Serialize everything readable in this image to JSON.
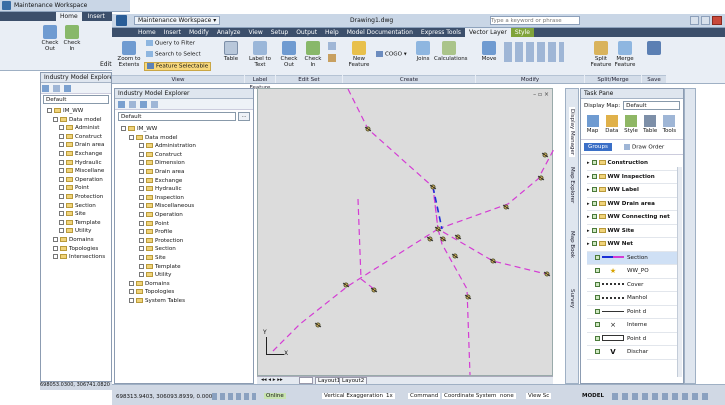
{
  "back_window": {
    "title": "Maintenance Workspace",
    "tab": "Home",
    "tab2": "Insert",
    "buttons": [
      "Check Out",
      "Check In"
    ],
    "edit_fragment": "Edit",
    "explorer_title": "Industry Model Explorer",
    "dropdown": "Default",
    "tree": [
      "IM_WW",
      "Data model",
      "Administ",
      "Construct",
      "Drain area",
      "Exchange",
      "Hydraulic",
      "Miscellane",
      "Operation",
      "Point",
      "Protection",
      "Section",
      "Site",
      "Template",
      "Utility",
      "Domains",
      "Topologies",
      "Intersections"
    ],
    "status": "698053.0300, 306741.0820"
  },
  "titlebar": {
    "workspace": "Maintenance Workspace",
    "doc": "Drawing1.dwg",
    "search_placeholder": "Type a keyword or phrase"
  },
  "ribbon": {
    "tabs": [
      "Home",
      "Insert",
      "Modify",
      "Analyze",
      "View",
      "Setup",
      "Output",
      "Help",
      "Model Documentation",
      "Express Tools",
      "Vector Layer",
      "Style"
    ],
    "buttons": {
      "zoom": "Zoom to Extents",
      "query": "Query to Filter",
      "search": "Search to Select",
      "feature_sel": "Feature Selectable",
      "table": "Table",
      "label": "Label to Text",
      "checkout": "Check Out",
      "checkin": "Check In",
      "newfeat": "New Feature",
      "cogo": "COGO",
      "joins": "Joins",
      "calc": "Calculations",
      "move": "Move",
      "split": "Split Feature",
      "merge": "Merge Feature",
      "save": "Save"
    },
    "groups": [
      "View",
      "Label Feature",
      "Edit Set",
      "Create",
      "Modify",
      "Split/Merge",
      "Save"
    ]
  },
  "explorer": {
    "title": "Industry Model Explorer",
    "dropdown": "Default",
    "tree": {
      "root": "IM_WW",
      "datamodel": "Data model",
      "items": [
        "Administration",
        "Construct",
        "Dimension",
        "Drain area",
        "Exchange",
        "Hydraulic",
        "Inspection",
        "Miscellaneous",
        "Operation",
        "Point",
        "Profile",
        "Protection",
        "Section",
        "Site",
        "Template",
        "Utility"
      ],
      "bottom": [
        "Domains",
        "Topologies",
        "System Tables"
      ]
    }
  },
  "map": {
    "layout_tabs": [
      "Layout1",
      "Layout2"
    ],
    "axis_y": "Y",
    "axis_x": "X"
  },
  "taskpane": {
    "title": "Task Pane",
    "display_map_label": "Display Map:",
    "display_map_value": "Default",
    "tools": [
      "Map",
      "Data",
      "Style",
      "Table",
      "Tools"
    ],
    "groups_btn": "Groups",
    "draw_order": "Draw Order",
    "layers": [
      "Construction",
      "WW Inspection",
      "WW Label",
      "WW Drain area",
      "WW Connecting net",
      "WW Site",
      "WW Net"
    ],
    "sublayers": [
      "Section",
      "WW_PO",
      "Cover",
      "Manhol",
      "Point d",
      "Interne",
      "Point d",
      "Dischar"
    ],
    "side_tabs": [
      "Display Manager",
      "Map Explorer",
      "Map Book",
      "Survey"
    ]
  },
  "status": {
    "coords": "698313.9403, 306093.8939, 0.0000",
    "items": [
      "Online",
      "Vertical Exaggeration",
      "1x",
      "Command",
      "Coordinate System",
      "none",
      "View Sc"
    ],
    "model": "MODEL"
  },
  "colors": {
    "network": "#d43cd4",
    "selected": "#1a2fd6",
    "ribbon_tab": "#3c4f6b",
    "active_context": "#7fa33a"
  }
}
